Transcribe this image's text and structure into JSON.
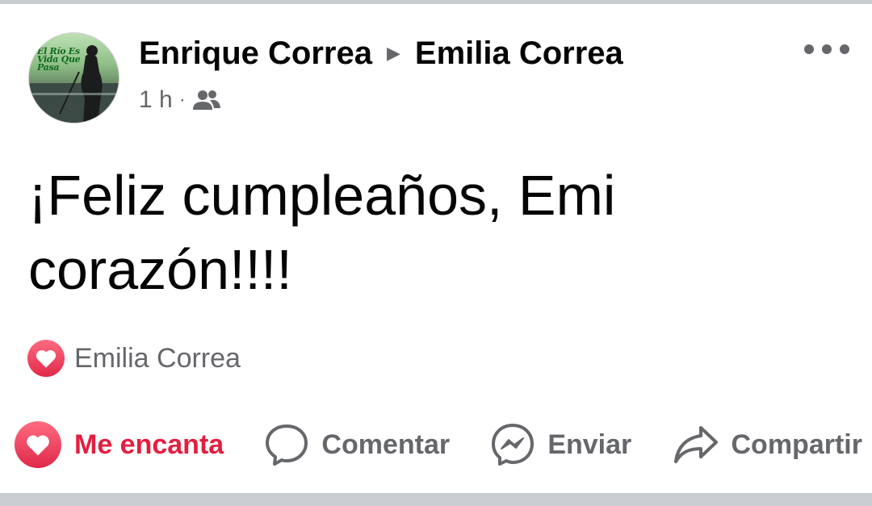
{
  "post": {
    "author": "Enrique Correa",
    "recipient": "Emilia Correa",
    "time": "1 h",
    "separator": "·",
    "audience_icon": "friends-icon",
    "avatar_text": "El Río Es Vida Que Pasa",
    "more_icon": "more-horizontal-icon",
    "text": "¡Feliz cumpleaños, Emi corazón!!!!",
    "reaction": {
      "icon": "love-reaction-icon",
      "names": "Emilia Correa"
    }
  },
  "actions": [
    {
      "label": "Me encanta",
      "icon": "heart-icon",
      "active": true
    },
    {
      "label": "Comentar",
      "icon": "comment-icon"
    },
    {
      "label": "Enviar",
      "icon": "messenger-icon"
    },
    {
      "label": "Compartir",
      "icon": "share-icon"
    }
  ],
  "colors": {
    "text_primary": "#050505",
    "text_secondary": "#65676b",
    "love": "#e41e3f",
    "separator": "#c9ccd1"
  }
}
